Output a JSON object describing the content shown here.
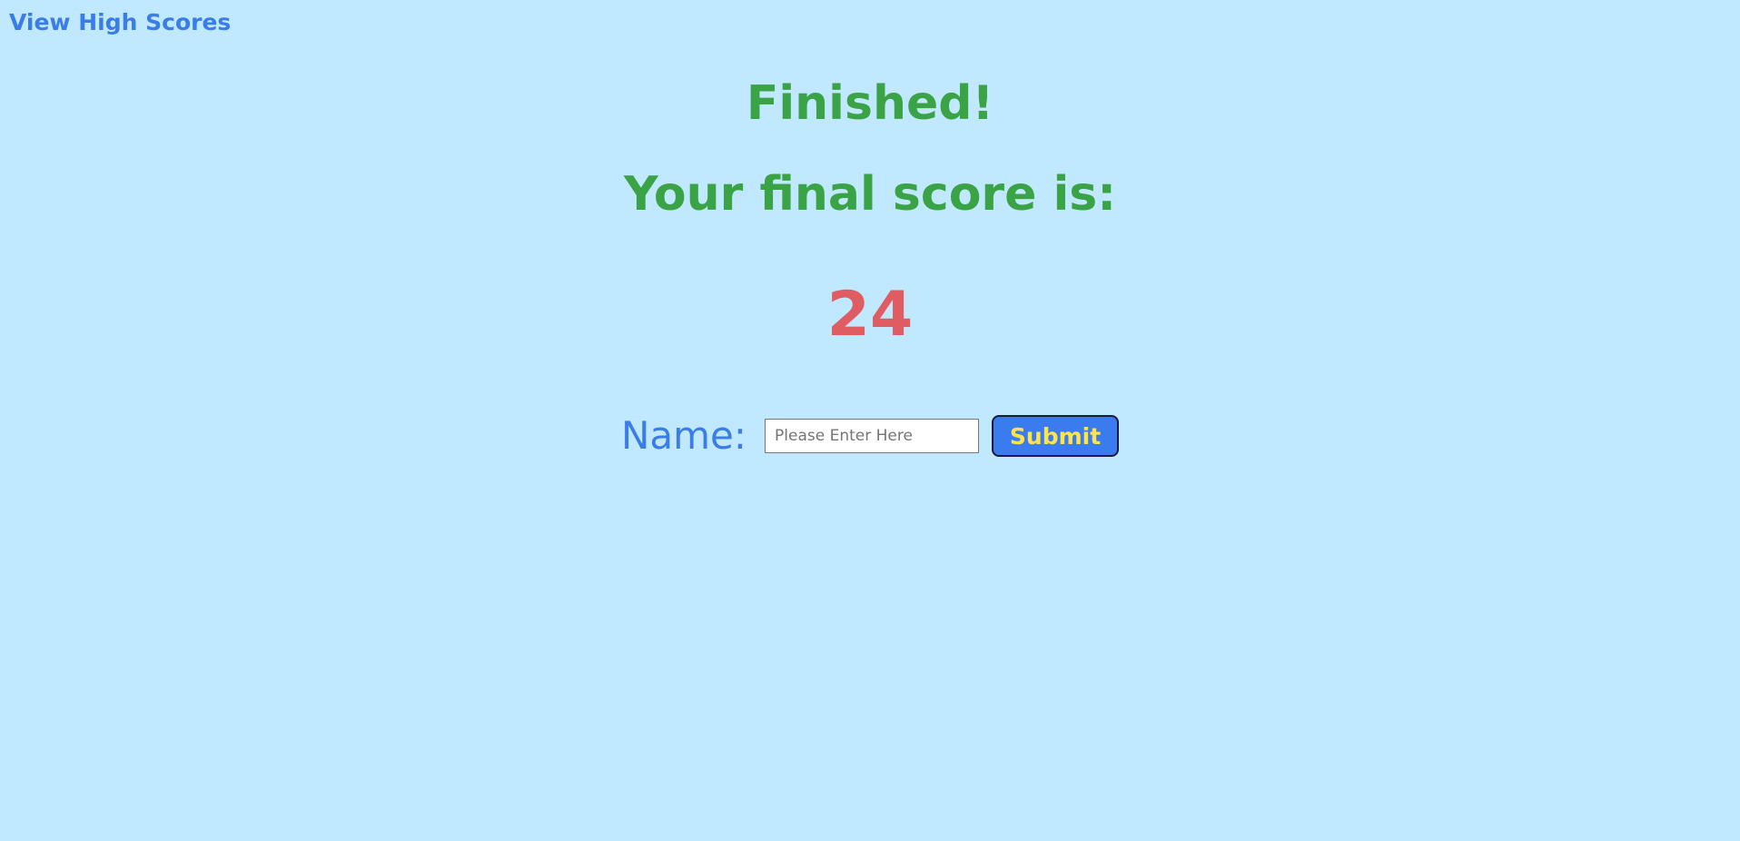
{
  "nav": {
    "high_scores_link": "View High Scores"
  },
  "result": {
    "heading": "Finished!",
    "score_label": "Your final score is:",
    "score_value": "24"
  },
  "form": {
    "name_label": "Name:",
    "name_placeholder": "Please Enter Here",
    "name_value": "",
    "submit_label": "Submit"
  },
  "colors": {
    "background": "#c0e8fe",
    "link": "#3a7ce8",
    "heading": "#3aa346",
    "score": "#e05c63",
    "button_bg": "#3a7cf0",
    "button_text": "#ffe34a"
  }
}
